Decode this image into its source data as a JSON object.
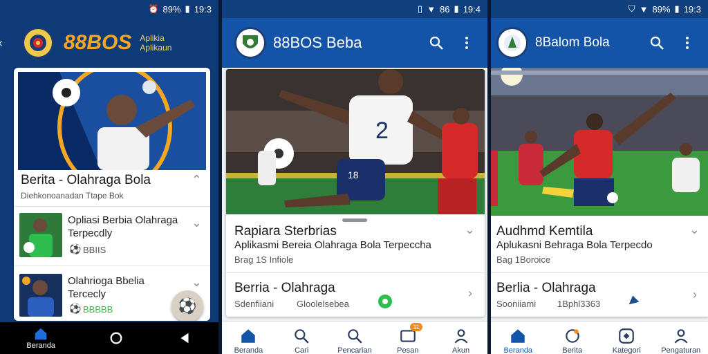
{
  "colors": {
    "brand_blue": "#1454a8",
    "status_blue": "#10407e",
    "accent_orange": "#f5a623",
    "green_live": "#2ebd4e",
    "jersey_red": "#d62a2a"
  },
  "panel1": {
    "status": {
      "battery": "89%",
      "time": "19:3"
    },
    "brand_logo": "88BOS",
    "brand_tag_line1": "Aplikia",
    "brand_tag_line2": "Aplikaun",
    "card_title": "Berita - Olahraga Bola",
    "card_sub": "Diehkonoanadan Ttape Bok",
    "item1_title_line1": "Opliasi Berbia Olahraga",
    "item1_title_line2": "Terpecdly",
    "item1_meta": "BBIIS",
    "item2_title_line1": "Olahrioga Bbelia",
    "item2_title_line2": "Tercecly",
    "item2_meta": "BBBBB",
    "nav_label": "Beranda",
    "icons": [
      "back-chevron-icon",
      "expand-chevron-icon",
      "ball-icon",
      "home-icon",
      "circle-home-icon",
      "back-triangle-icon"
    ]
  },
  "panel2": {
    "status": {
      "battery": "86",
      "time": "19:4"
    },
    "title": "88BOS Beba",
    "jersey_number": "2",
    "short_number": "18",
    "card_title": "Rapiara Sterbrias",
    "card_sub": "Aplikasmi Bereia Olahraga Bola Terpeccha",
    "card_meta": "Brag 1S Infiole",
    "row_title": "Berria - Olahraga",
    "row_left": "Sdenfiiani",
    "row_right": "Gloolelsebea",
    "nav": [
      {
        "label": "Beranda",
        "icon": "home-icon"
      },
      {
        "label": "Cari",
        "icon": "search-icon"
      },
      {
        "label": "Pencarian",
        "icon": "search-icon"
      },
      {
        "label": "Pesan",
        "icon": "message-icon",
        "badge": "11"
      },
      {
        "label": "Akun",
        "icon": "profile-icon"
      }
    ]
  },
  "panel3": {
    "status": {
      "battery": "89%",
      "time": "19:3"
    },
    "title": "8Balom Bola",
    "card_title": "Audhmd Kemtila",
    "card_sub": "Aplukasni Behraga Bola Terpecdo",
    "card_meta": "Bag 1Boroice",
    "row_title": "Berlia - Olahraga",
    "row_left": "Sooniiami",
    "row_right": "1Bphl3363",
    "nav": [
      {
        "label": "Beranda",
        "icon": "home-icon"
      },
      {
        "label": "Berita",
        "icon": "chat-icon"
      },
      {
        "label": "Kategori",
        "icon": "ball-icon"
      },
      {
        "label": "Pengaturan",
        "icon": "profile-icon"
      }
    ]
  }
}
